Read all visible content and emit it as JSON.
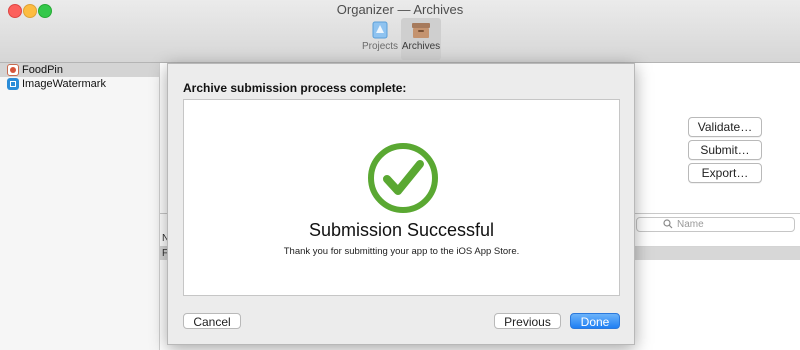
{
  "window": {
    "title": "Organizer — Archives"
  },
  "toolbar": {
    "items": [
      {
        "label": "Projects",
        "icon": "projects-icon",
        "selected": false
      },
      {
        "label": "Archives",
        "icon": "archives-icon",
        "selected": true
      }
    ]
  },
  "sidebar": {
    "items": [
      {
        "label": "FoodPin",
        "icon": "foodpin-app-icon",
        "selected": true
      },
      {
        "label": "ImageWatermark",
        "icon": "imagewatermark-app-icon",
        "selected": false
      }
    ]
  },
  "main": {
    "buttons": {
      "validate": "Validate…",
      "submit": "Submit…",
      "export": "Export…"
    },
    "search": {
      "placeholder": "Name"
    },
    "list": {
      "header_fragment": "N",
      "row_fragment": "F"
    }
  },
  "sheet": {
    "heading": "Archive submission process complete:",
    "result_title": "Submission Successful",
    "result_message": "Thank you for submitting your app to the iOS App Store.",
    "buttons": {
      "cancel": "Cancel",
      "previous": "Previous",
      "done": "Done"
    }
  },
  "colors": {
    "success_green": "#5aa832",
    "done_blue": "#1f7ff3",
    "close_red": "#fc605c",
    "minimize_yellow": "#fdbc40",
    "zoom_green": "#34c84a"
  }
}
